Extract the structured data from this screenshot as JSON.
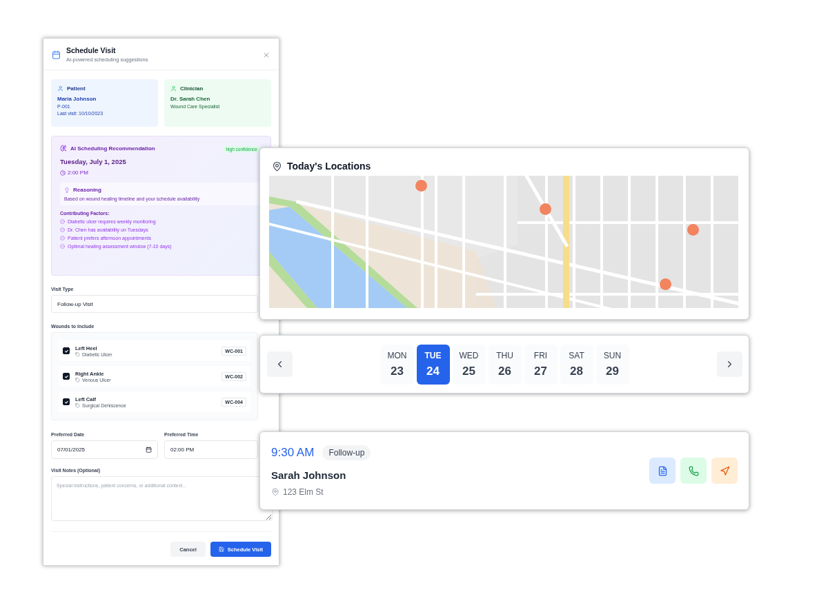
{
  "dialog": {
    "title": "Schedule Visit",
    "subtitle": "AI-powered scheduling suggestions"
  },
  "people": [
    {
      "kind": "patient",
      "heading": "Patient",
      "name": "Maria Johnson",
      "lines": [
        "P-001",
        "Last visit: 10/10/2023"
      ]
    },
    {
      "kind": "clinician",
      "heading": "Clinician",
      "name": "Dr. Sarah Chen",
      "lines": [
        "Wound Care Specialist"
      ]
    }
  ],
  "recommendation": {
    "title": "AI Scheduling Recommendation",
    "badge": "high confidence",
    "date": "Tuesday, July 1, 2025",
    "time": "2:00 PM",
    "reasoning_title": "Reasoning",
    "reasoning": "Based on wound healing timeline and your schedule availability",
    "factors_title": "Contributing Factors:",
    "factors": [
      "Diabetic ulcer requires weekly monitoring",
      "Dr. Chen has availability on Tuesdays",
      "Patient prefers afternoon appointments",
      "Optimal healing assessment window (7-10 days)"
    ]
  },
  "visit_type": {
    "label": "Visit Type",
    "value": "Follow-up Visit"
  },
  "wounds": {
    "label": "Wounds to Include",
    "items": [
      {
        "location": "Left Heel",
        "type": "Diabetic Ulcer",
        "code": "WC-001",
        "checked": true
      },
      {
        "location": "Right Ankle",
        "type": "Venous Ulcer",
        "code": "WC-002",
        "checked": true
      },
      {
        "location": "Left Calf",
        "type": "Surgical Dehiscence",
        "code": "WC-004",
        "checked": true
      }
    ]
  },
  "date_field": {
    "label": "Preferred Date",
    "value": "07/01/2025"
  },
  "time_field": {
    "label": "Preferred Time",
    "value": "02:00 PM"
  },
  "notes": {
    "label": "Visit Notes (Optional)",
    "placeholder": "Special instructions, patient concerns, or additional context..."
  },
  "buttons": [
    {
      "kind": "secondary",
      "label": "Cancel"
    },
    {
      "kind": "primary",
      "label": "Schedule Visit"
    }
  ],
  "map_card": {
    "title": "Today's Locations"
  },
  "week": {
    "days": [
      {
        "day": "MON",
        "date": "23",
        "selected": false
      },
      {
        "day": "TUE",
        "date": "24",
        "selected": true
      },
      {
        "day": "WED",
        "date": "25",
        "selected": false
      },
      {
        "day": "THU",
        "date": "26",
        "selected": false
      },
      {
        "day": "FRI",
        "date": "27",
        "selected": false
      },
      {
        "day": "SAT",
        "date": "28",
        "selected": false
      },
      {
        "day": "SUN",
        "date": "29",
        "selected": false
      }
    ]
  },
  "appointment": {
    "time": "9:30 AM",
    "type": "Follow-up",
    "patient": "Sarah Johnson",
    "address": "123 Elm St"
  }
}
